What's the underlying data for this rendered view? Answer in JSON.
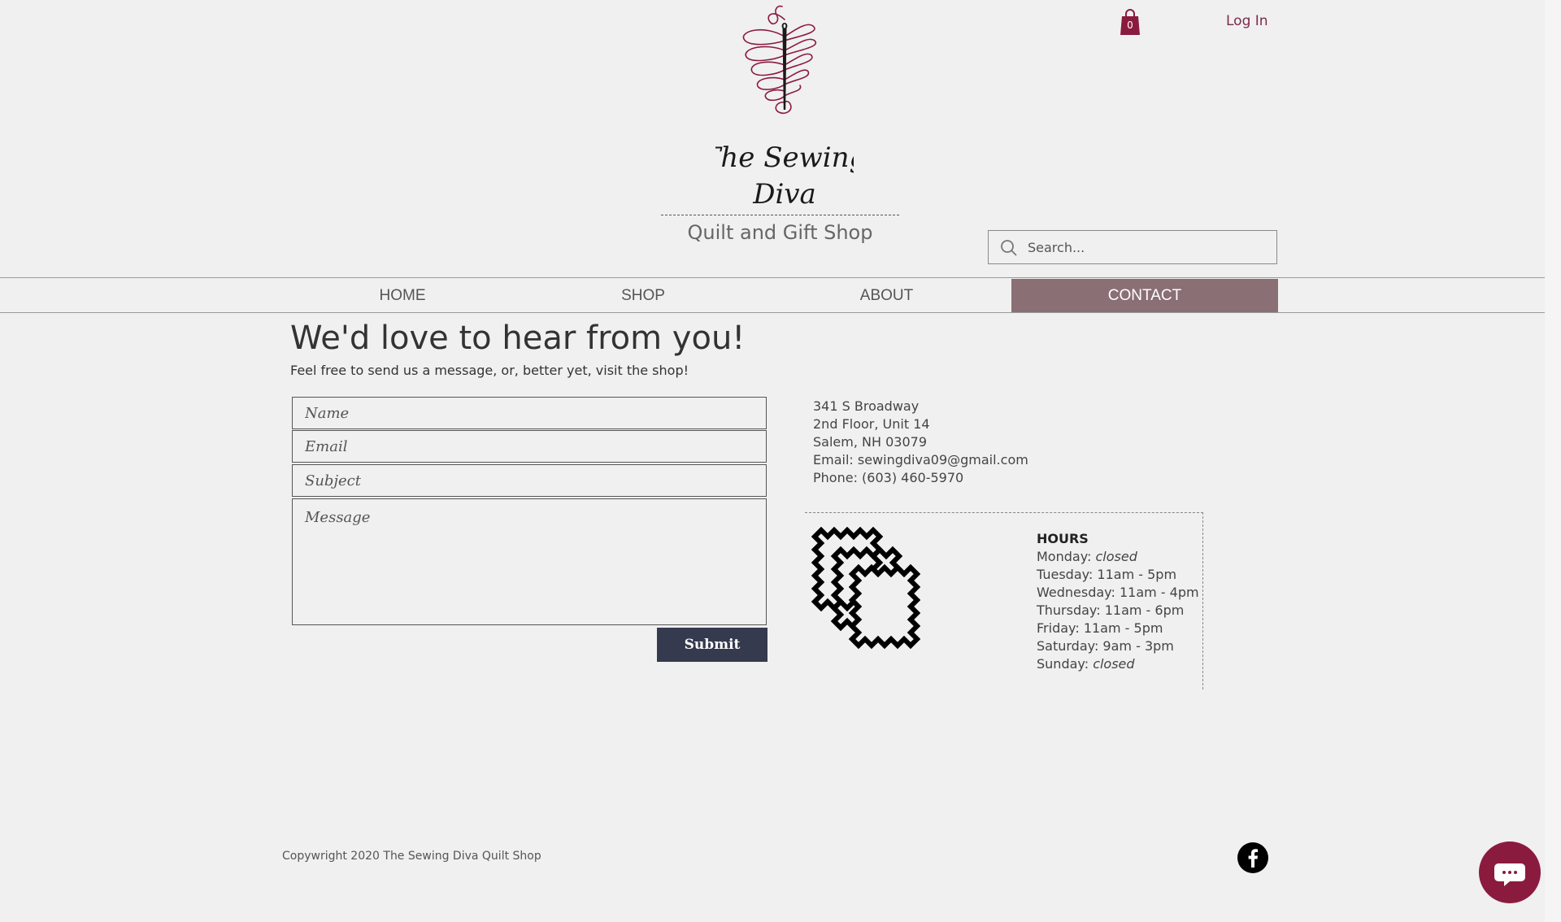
{
  "header": {
    "logo_text": "The Sewing Diva",
    "tagline": "Quilt and Gift Shop",
    "cart_icon": "shopping-bag-icon",
    "cart_count": "0",
    "login_label": "Log In",
    "search_placeholder": "Search..."
  },
  "nav": {
    "items": [
      {
        "label": "HOME"
      },
      {
        "label": "SHOP"
      },
      {
        "label": "ABOUT"
      },
      {
        "label": "CONTACT",
        "active": true
      }
    ]
  },
  "contact": {
    "title": "We'd love to hear from you!",
    "subtitle": "Feel free to send us a message, or, better yet, visit the shop!",
    "form": {
      "name_placeholder": "Name",
      "email_placeholder": "Email",
      "subject_placeholder": "Subject",
      "message_placeholder": "Message",
      "submit_label": "Submit"
    }
  },
  "address": {
    "line1": "341 S Broadway",
    "line2": "2nd Floor, Unit 14",
    "line3": "Salem, NH 03079",
    "email_label": "Email: ",
    "email": "sewingdiva09@gmail.com",
    "phone_label": "Phone: ",
    "phone": "(603) 460-5970"
  },
  "hours": {
    "title": "HOURS",
    "days": [
      {
        "day": "Monday: ",
        "time": "closed",
        "italic": true
      },
      {
        "day": "Tuesday: ",
        "time": "11am - 5pm"
      },
      {
        "day": "Wednesday: ",
        "time": "11am - 4pm"
      },
      {
        "day": "Thursday: ",
        "time": "11am - 6pm"
      },
      {
        "day": "Friday: ",
        "time": "11am - 5pm"
      },
      {
        "day": "Saturday: ",
        "time": "9am - 3pm"
      },
      {
        "day": "Sunday: ",
        "time": "closed",
        "italic": true
      }
    ]
  },
  "footer": {
    "copyright": "Copywright 2020 The Sewing Diva Quilt Shop",
    "social_icon": "facebook-icon",
    "chat_icon": "chat-icon"
  },
  "colors": {
    "brand": "#8b1a3f",
    "nav_active_bg": "#8a6f74",
    "submit_bg": "#363a4f",
    "background": "#f0f0f0"
  }
}
